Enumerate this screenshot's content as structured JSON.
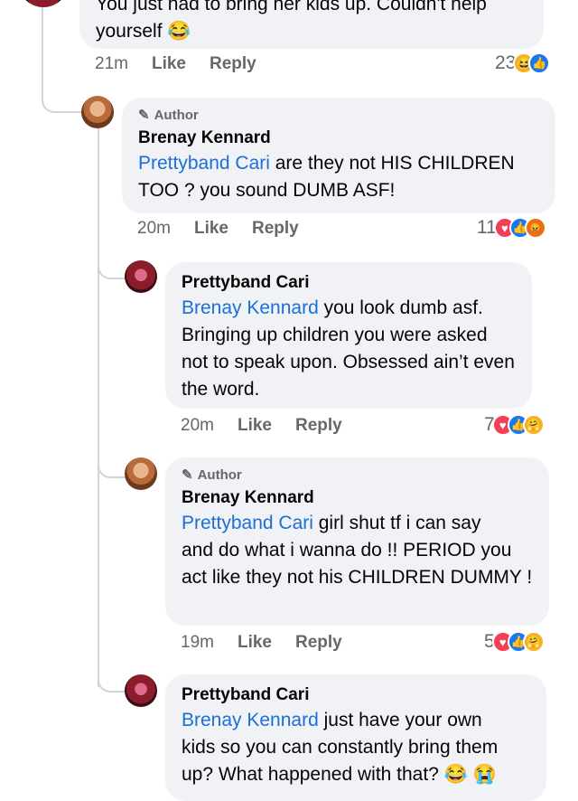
{
  "comments": [
    {
      "name": "",
      "author_badge": "",
      "text_lines": [
        "You just had to bring her kids up. Couldn't help",
        "yourself 😂"
      ],
      "time": "21m",
      "like": "Like",
      "reply": "Reply",
      "count": "23",
      "reactions": [
        "haha-icon",
        "like-icon"
      ]
    },
    {
      "name": "Brenay Kennard",
      "author_badge": "Author",
      "mention": "Prettyband Cari",
      "text_first": " are they not HIS CHILDREN",
      "text_rest": "TOO ? you sound DUMB ASF!",
      "time": "20m",
      "like": "Like",
      "reply": "Reply",
      "count": "11",
      "reactions": [
        "love-icon",
        "like-icon",
        "angry-icon"
      ]
    },
    {
      "name": "Prettyband Cari",
      "mention": "Brenay Kennard",
      "text_first": " you look dumb asf.",
      "text_rest": "Bringing up children you were asked not to speak upon. Obsessed ain’t even the word.",
      "time": "20m",
      "like": "Like",
      "reply": "Reply",
      "count": "7",
      "reactions": [
        "love-icon",
        "like-icon",
        "care-icon"
      ]
    },
    {
      "name": "Brenay Kennard",
      "author_badge": "Author",
      "mention": "Prettyband Cari",
      "text_first": " girl shut tf i can say",
      "text_rest": "and do what i wanna do !! PERIOD you act like they not his CHILDREN DUMMY !",
      "time": "19m",
      "like": "Like",
      "reply": "Reply",
      "count": "5",
      "reactions": [
        "love-icon",
        "like-icon",
        "care-icon"
      ]
    },
    {
      "name": "Prettyband Cari",
      "mention": "Brenay Kennard",
      "text_first": " just have your own",
      "text_rest": "kids so you can constantly bring them up? What happened with that? 😂 😭"
    }
  ]
}
